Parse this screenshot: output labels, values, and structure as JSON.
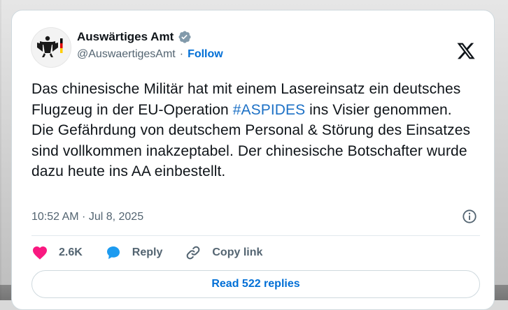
{
  "tweet": {
    "author_name": "Auswärtiges Amt",
    "author_handle": "@AuswaertigesAmt",
    "separator": "·",
    "follow_label": "Follow",
    "text_before_hashtag": "Das chinesische Militär hat mit einem Lasereinsatz ein deutsches Flugzeug in der EU-Operation ",
    "hashtag": "#ASPIDES",
    "text_after_hashtag": " ins Visier genommen. Die Gefährdung von deutschem Personal & Störung des Einsatzes sind vollkommen inakzeptabel. Der chinesische Botschafter wurde dazu heute ins AA einbestellt.",
    "timestamp": "10:52 AM · Jul 8, 2025",
    "likes_count": "2.6K",
    "reply_label": "Reply",
    "copy_link_label": "Copy link",
    "read_replies_label": "Read 522 replies"
  },
  "icons": {
    "avatar": "federal-eagle-logo",
    "verified": "verified-badge-icon",
    "platform": "x-logo-icon",
    "info": "info-icon",
    "like": "heart-icon",
    "reply": "speech-bubble-icon",
    "copy_link": "link-icon"
  },
  "colors": {
    "accent": "#006fd6",
    "like": "#f91880",
    "reply_icon": "#1d9bf0",
    "verified_badge": "#829aab",
    "text": "#0f1419",
    "secondary_text": "#536471"
  }
}
